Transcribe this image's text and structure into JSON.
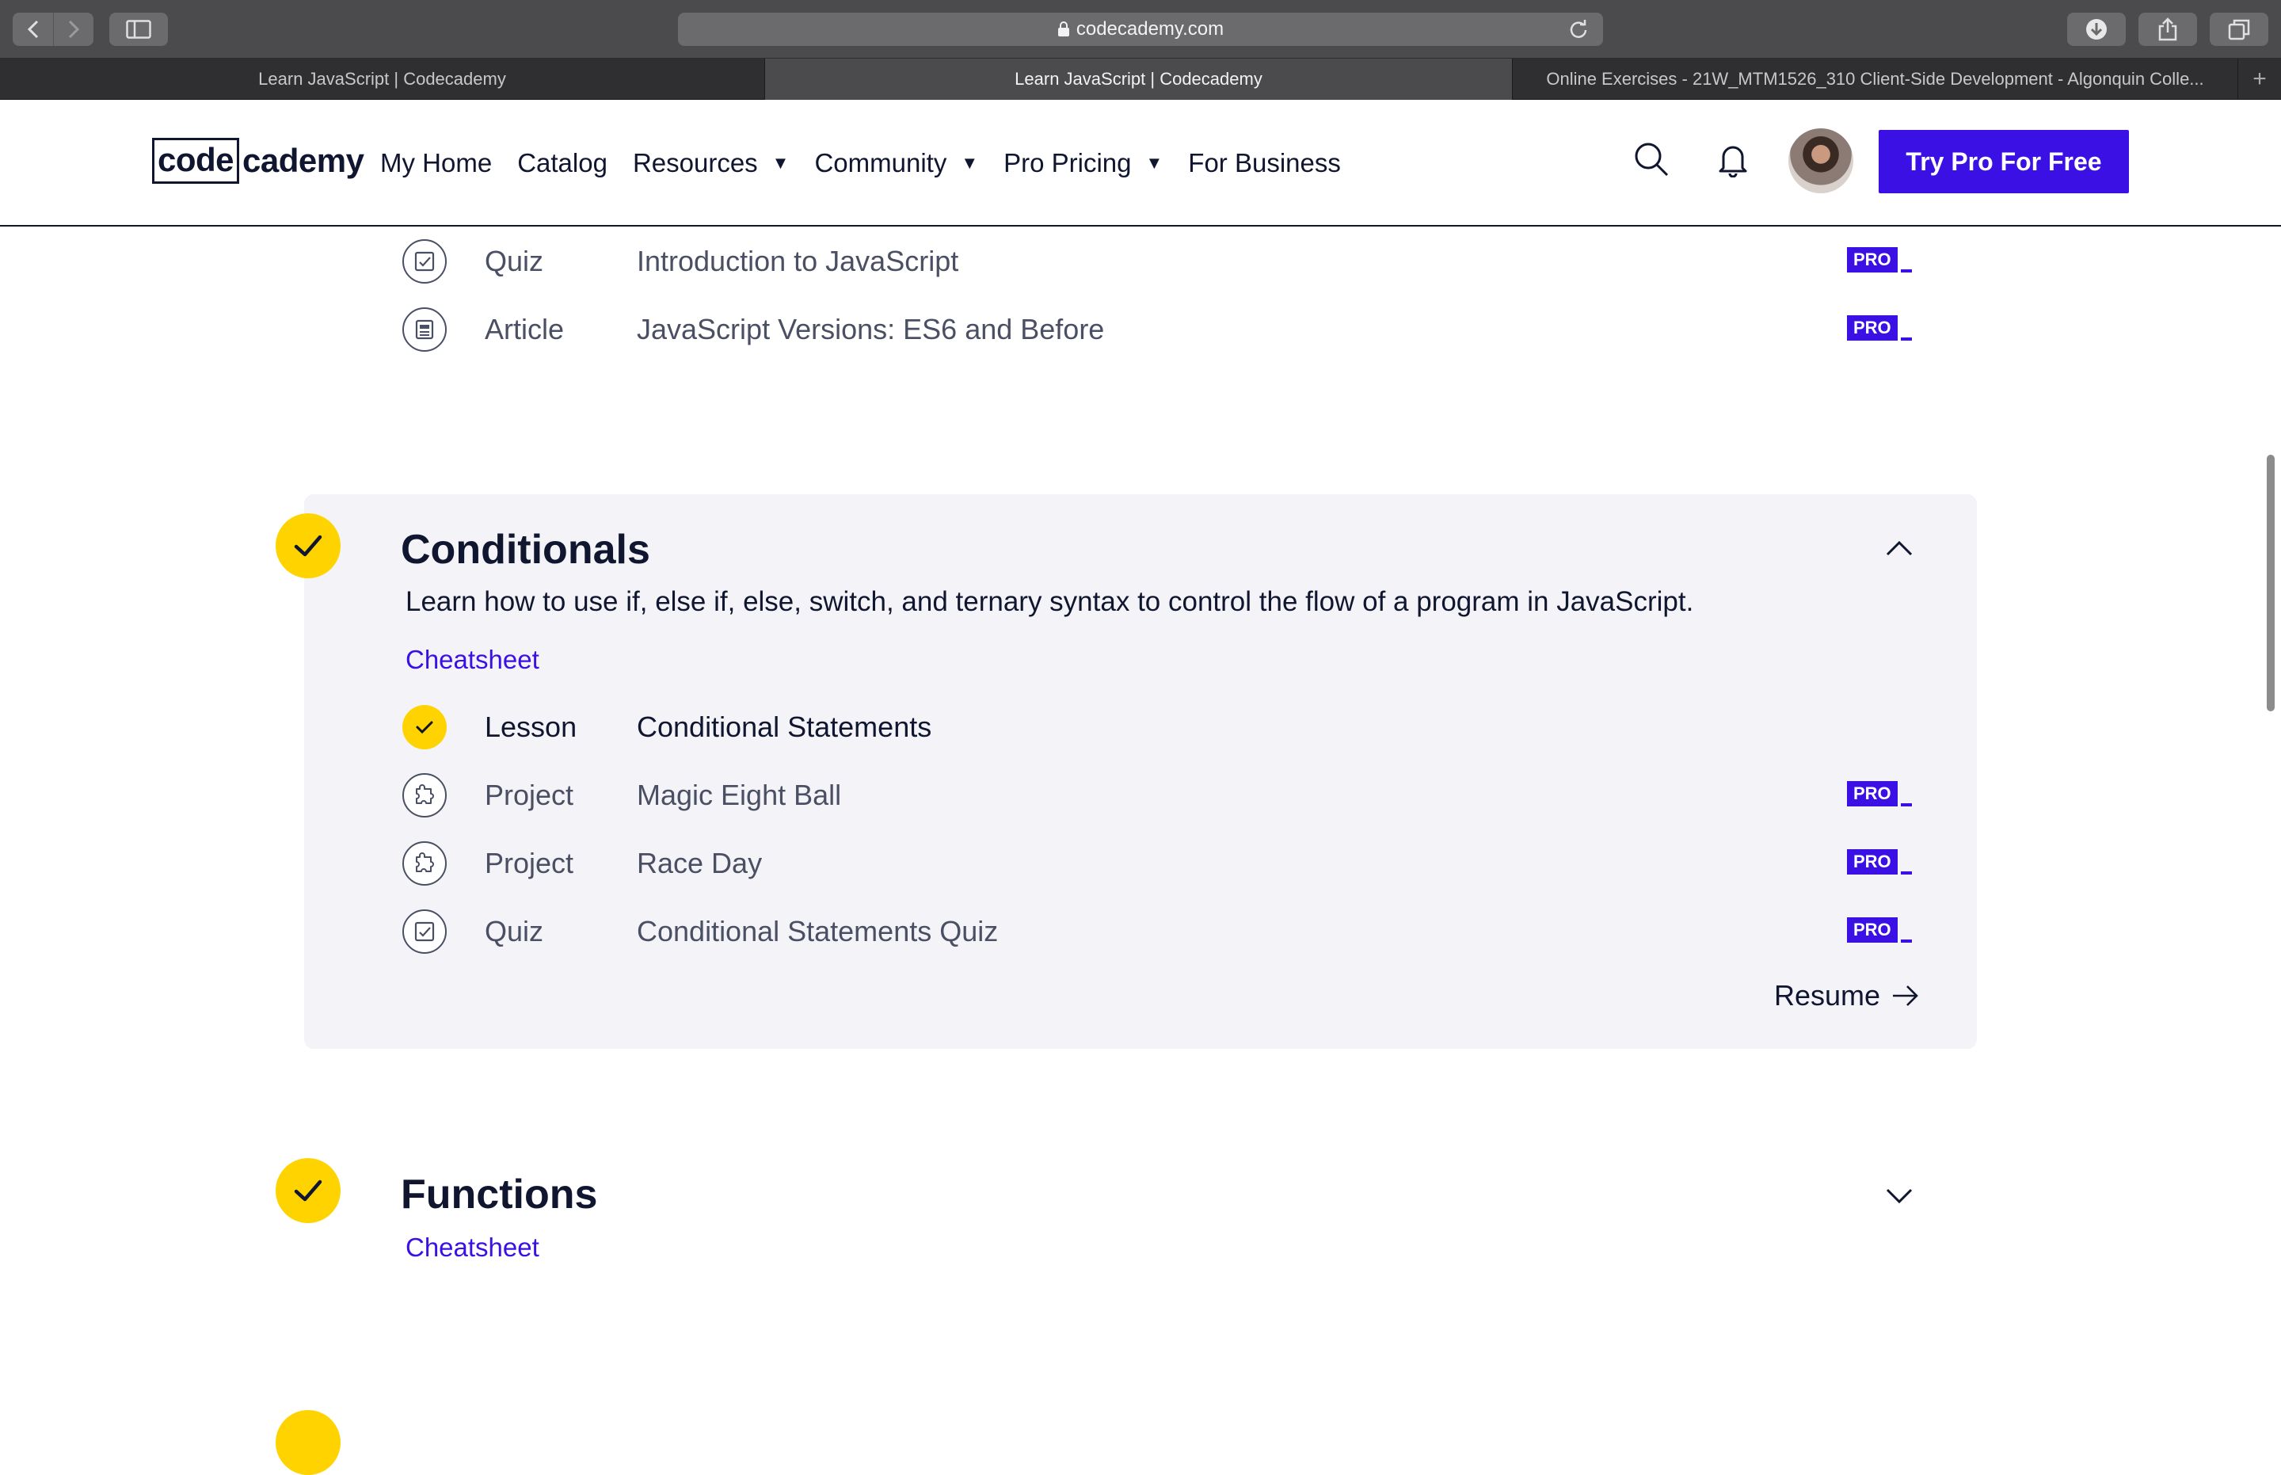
{
  "browser": {
    "url": "codecademy.com",
    "tabs": [
      {
        "label": "Learn JavaScript | Codecademy",
        "active": false
      },
      {
        "label": "Learn JavaScript | Codecademy",
        "active": true
      },
      {
        "label": "Online Exercises - 21W_MTM1526_310 Client-Side Development - Algonquin Colle...",
        "active": false
      }
    ],
    "new_tab": "+"
  },
  "header": {
    "logo_boxed": "code",
    "logo_rest": "cademy",
    "nav": [
      {
        "label": "My Home",
        "dropdown": false
      },
      {
        "label": "Catalog",
        "dropdown": false
      },
      {
        "label": "Resources",
        "dropdown": true
      },
      {
        "label": "Community",
        "dropdown": true
      },
      {
        "label": "Pro Pricing",
        "dropdown": true
      },
      {
        "label": "For Business",
        "dropdown": false
      }
    ],
    "cta": "Try Pro For Free"
  },
  "prev_module_items": [
    {
      "type": "Quiz",
      "title": "Introduction to JavaScript",
      "icon": "quiz-icon",
      "pro": "PRO"
    },
    {
      "type": "Article",
      "title": "JavaScript Versions: ES6 and Before",
      "icon": "article-icon",
      "pro": "PRO"
    }
  ],
  "conditionals": {
    "title": "Conditionals",
    "completed": true,
    "expanded": true,
    "description": "Learn how to use if, else if, else, switch, and ternary syntax to control the flow of a program in JavaScript.",
    "cheatsheet": "Cheatsheet",
    "items": [
      {
        "type": "Lesson",
        "title": "Conditional Statements",
        "icon": "check-icon",
        "done": true,
        "pro": ""
      },
      {
        "type": "Project",
        "title": "Magic Eight Ball",
        "icon": "puzzle-icon",
        "done": false,
        "pro": "PRO"
      },
      {
        "type": "Project",
        "title": "Race Day",
        "icon": "puzzle-icon",
        "done": false,
        "pro": "PRO"
      },
      {
        "type": "Quiz",
        "title": "Conditional Statements Quiz",
        "icon": "quiz-icon",
        "done": false,
        "pro": "PRO"
      }
    ],
    "resume": "Resume"
  },
  "functions": {
    "title": "Functions",
    "completed": true,
    "expanded": false,
    "cheatsheet": "Cheatsheet"
  },
  "colors": {
    "brand": "#3a10e5",
    "navy": "#10162f",
    "yellow": "#ffd300",
    "card_bg": "#f4f4f8"
  }
}
